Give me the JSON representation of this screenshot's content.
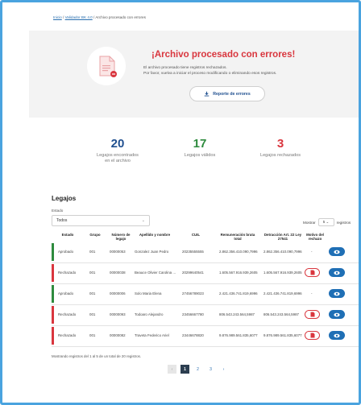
{
  "breadcrumb": {
    "home": "Inicio",
    "sep1": "/",
    "section": "Validador BK 4.0",
    "sep2": "/",
    "current": "Archivo procesado con errores"
  },
  "hero": {
    "title": "¡Archivo procesado con errores!",
    "line1": "El archivo procesado tiene registros rechazados.",
    "line2": "Por favor, vuelva a iniciar el proceso modificando o eliminando esos registros.",
    "report_button": "Reporte de errores"
  },
  "stats": [
    {
      "value": "20",
      "label1": "Legajos encontrados",
      "label2": "en el archivo",
      "color": "#1f4f8f"
    },
    {
      "value": "17",
      "label1": "Legajos válidos",
      "label2": "",
      "color": "#2e8b3e"
    },
    {
      "value": "3",
      "label1": "Legajos rechazados",
      "label2": "",
      "color": "#d9363e"
    }
  ],
  "legajos": {
    "title": "Legajos",
    "estado_label": "Estado",
    "estado_value": "Todos",
    "mostrar_label": "Mostrar",
    "mostrar_value": "5",
    "registros_label": "registros"
  },
  "table": {
    "headers": [
      "Estado",
      "Grupo",
      "Número de legajo",
      "Apellido y nombre",
      "CUIL",
      "Remuneración bruta total",
      "Detracción Art. 22 Ley 27541",
      "Motivo del rechazo"
    ],
    "rows": [
      {
        "estado": "Aprobado",
        "grupo": "001",
        "legajo": "00000053",
        "nombre": "Gonzalez Juan Pedro",
        "cuil": "20235555555",
        "remuneracion": "2.862.356.410.090,7996",
        "detraccion": "2.862.356.410.090,7996",
        "motivo": "-",
        "status_color": "#2e8b3e"
      },
      {
        "estado": "Rechazado",
        "grupo": "001",
        "legajo": "00000038",
        "nombre": "Beauce Olivier Carolina ...",
        "cuil": "20299640541",
        "remuneracion": "1.605.567.916.939,2605",
        "detraccion": "1.605.567.916.939,2605",
        "motivo": "pdf",
        "status_color": "#d9363e"
      },
      {
        "estado": "Aprobado",
        "grupo": "001",
        "legajo": "00000006",
        "nombre": "Solo Maria Elena",
        "cuil": "27456789023",
        "remuneracion": "2.421.436.741.819,6996",
        "detraccion": "2.421.436.741.819,6996",
        "motivo": "-",
        "status_color": "#2e8b3e"
      },
      {
        "estado": "Rechazado",
        "grupo": "001",
        "legajo": "00000093",
        "nombre": "Todoaro Alejandro",
        "cuil": "23456667780",
        "remuneracion": "806.543.243.564,5987",
        "detraccion": "806.543.243.564,5987",
        "motivo": "pdf",
        "status_color": "#d9363e"
      },
      {
        "estado": "Rechazado",
        "grupo": "001",
        "legajo": "00000082",
        "nombre": "Traveta Federico Ariel",
        "cuil": "23446678820",
        "remuneracion": "9.876.989.561.835,6077",
        "detraccion": "9.876.989.561.835,6077",
        "motivo": "pdf",
        "status_color": "#d9363e"
      }
    ]
  },
  "footer_text": "Mostrando registros del 1 al 5 de un total de 20 registros.",
  "pagination": {
    "prev": "‹",
    "pages": [
      "1",
      "2",
      "3"
    ],
    "next": "›"
  },
  "colors": {
    "accent": "#1f6fb5",
    "error": "#d9363e",
    "success": "#2e8b3e",
    "frame": "#4aa3df"
  }
}
